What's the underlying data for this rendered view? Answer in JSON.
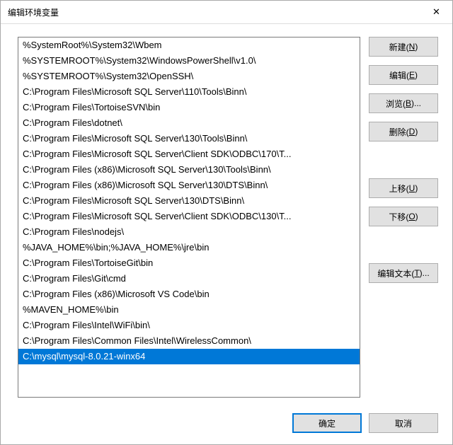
{
  "window": {
    "title": "编辑环境变量",
    "close_symbol": "✕"
  },
  "list": {
    "selected_index": 20,
    "items": [
      "%SystemRoot%\\System32\\Wbem",
      "%SYSTEMROOT%\\System32\\WindowsPowerShell\\v1.0\\",
      "%SYSTEMROOT%\\System32\\OpenSSH\\",
      "C:\\Program Files\\Microsoft SQL Server\\110\\Tools\\Binn\\",
      "C:\\Program Files\\TortoiseSVN\\bin",
      "C:\\Program Files\\dotnet\\",
      "C:\\Program Files\\Microsoft SQL Server\\130\\Tools\\Binn\\",
      "C:\\Program Files\\Microsoft SQL Server\\Client SDK\\ODBC\\170\\T...",
      "C:\\Program Files (x86)\\Microsoft SQL Server\\130\\Tools\\Binn\\",
      "C:\\Program Files (x86)\\Microsoft SQL Server\\130\\DTS\\Binn\\",
      "C:\\Program Files\\Microsoft SQL Server\\130\\DTS\\Binn\\",
      "C:\\Program Files\\Microsoft SQL Server\\Client SDK\\ODBC\\130\\T...",
      "C:\\Program Files\\nodejs\\",
      "%JAVA_HOME%\\bin;%JAVA_HOME%\\jre\\bin",
      "C:\\Program Files\\TortoiseGit\\bin",
      "C:\\Program Files\\Git\\cmd",
      "C:\\Program Files (x86)\\Microsoft VS Code\\bin",
      "%MAVEN_HOME%\\bin",
      "C:\\Program Files\\Intel\\WiFi\\bin\\",
      "C:\\Program Files\\Common Files\\Intel\\WirelessCommon\\",
      "C:\\mysql\\mysql-8.0.21-winx64"
    ]
  },
  "buttons": {
    "new": {
      "text": "新建(",
      "hotkey": "N",
      "suffix": ")"
    },
    "edit": {
      "text": "编辑(",
      "hotkey": "E",
      "suffix": ")"
    },
    "browse": {
      "text": "浏览(",
      "hotkey": "B",
      "suffix": ")..."
    },
    "delete": {
      "text": "删除(",
      "hotkey": "D",
      "suffix": ")"
    },
    "move_up": {
      "text": "上移(",
      "hotkey": "U",
      "suffix": ")"
    },
    "move_down": {
      "text": "下移(",
      "hotkey": "O",
      "suffix": ")"
    },
    "edit_text": {
      "text": "编辑文本(",
      "hotkey": "T",
      "suffix": ")..."
    },
    "ok": "确定",
    "cancel": "取消"
  }
}
